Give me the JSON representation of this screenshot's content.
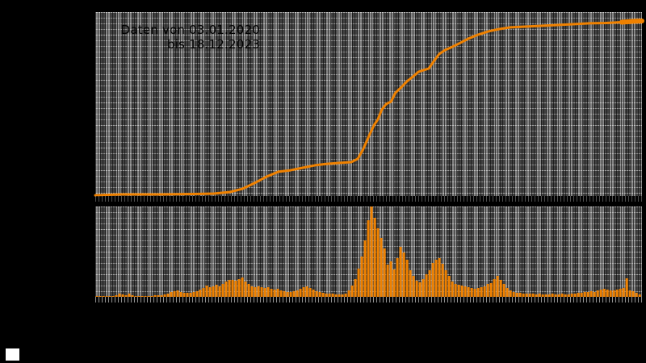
{
  "window": {
    "background": "#000000"
  },
  "annotation": {
    "line1": "Daten von 03.01.2020",
    "line2": "bis 18.12.2023"
  },
  "colors": {
    "accent_orange": "#ef8100",
    "panel_bg": "#636363",
    "grid_light": "#9a9a9a",
    "grid_dark": "#141414",
    "annotation_text": "#000000",
    "white_marker": "#ffffff",
    "frame_black": "#000000"
  },
  "chart_data": [
    {
      "id": "cumulative",
      "type": "line",
      "title": "",
      "description": "Top panel: cumulative total over time, orange line on dark gridded background",
      "x_range": {
        "start_label": "03.01.2020",
        "end_label": "18.12.2023"
      },
      "axis_tick_labels_visible": false,
      "grid": true,
      "legend_position": "none",
      "end_cap_thick": true,
      "points_pct": [
        [
          0,
          0.4
        ],
        [
          4.7,
          0.9
        ],
        [
          12.1,
          0.9
        ],
        [
          18.0,
          1.1
        ],
        [
          21.7,
          1.3
        ],
        [
          24.7,
          2.2
        ],
        [
          26.9,
          3.9
        ],
        [
          29.1,
          7.0
        ],
        [
          31.3,
          10.5
        ],
        [
          33.5,
          13.2
        ],
        [
          35.7,
          14.0
        ],
        [
          38.0,
          15.4
        ],
        [
          40.2,
          16.7
        ],
        [
          42.4,
          17.5
        ],
        [
          44.6,
          18.0
        ],
        [
          46.8,
          18.4
        ],
        [
          48.0,
          20.2
        ],
        [
          49.0,
          25.4
        ],
        [
          50.1,
          32.9
        ],
        [
          51.0,
          38.6
        ],
        [
          51.7,
          41.7
        ],
        [
          52.4,
          46.9
        ],
        [
          53.2,
          50.0
        ],
        [
          54.1,
          51.3
        ],
        [
          54.9,
          56.1
        ],
        [
          56.0,
          59.2
        ],
        [
          57.0,
          62.3
        ],
        [
          58.1,
          64.9
        ],
        [
          59.1,
          67.5
        ],
        [
          60.0,
          68.4
        ],
        [
          61.0,
          69.3
        ],
        [
          61.9,
          73.2
        ],
        [
          62.9,
          77.2
        ],
        [
          64.0,
          79.4
        ],
        [
          65.3,
          81.1
        ],
        [
          66.8,
          83.3
        ],
        [
          68.2,
          85.5
        ],
        [
          70.0,
          87.7
        ],
        [
          71.9,
          89.5
        ],
        [
          73.9,
          90.8
        ],
        [
          75.9,
          91.7
        ],
        [
          78.6,
          92.1
        ],
        [
          81.2,
          92.5
        ],
        [
          84.5,
          93.0
        ],
        [
          87.4,
          93.4
        ],
        [
          90.4,
          93.9
        ],
        [
          93.4,
          94.1
        ],
        [
          96.3,
          94.5
        ],
        [
          98.5,
          95.0
        ],
        [
          100,
          95.2
        ]
      ]
    },
    {
      "id": "daily",
      "type": "bar",
      "title": "",
      "description": "Bottom panel: daily values as dense orange spikes, tallest cluster at ~52% of time axis",
      "axis_tick_labels_visible": false,
      "grid": true,
      "legend_position": "none",
      "x_start_pct": 0.295,
      "x_step_pct": 0.591,
      "bar_width_pct": 0.45,
      "values_pct": [
        0.9,
        0.9,
        0.9,
        0.9,
        0.9,
        0.9,
        1.8,
        3.6,
        2.7,
        1.8,
        3.6,
        1.8,
        0.9,
        0.9,
        0.9,
        0.9,
        0.9,
        0.9,
        1.8,
        1.8,
        1.8,
        2.7,
        3.6,
        5.4,
        6.3,
        7.1,
        5.4,
        4.5,
        4.5,
        4.5,
        5.4,
        6.3,
        8.0,
        9.8,
        12.5,
        10.7,
        11.6,
        13.4,
        11.6,
        14.3,
        17.0,
        18.8,
        18.8,
        17.9,
        19.6,
        21.4,
        17.0,
        14.3,
        11.6,
        10.7,
        11.6,
        10.7,
        9.8,
        10.7,
        8.9,
        8.0,
        8.9,
        7.1,
        6.3,
        5.4,
        5.4,
        6.3,
        7.1,
        8.9,
        10.7,
        11.6,
        9.8,
        8.0,
        6.3,
        5.4,
        4.5,
        3.6,
        3.6,
        3.6,
        2.7,
        2.7,
        2.7,
        3.6,
        7.1,
        12.5,
        19.6,
        31.3,
        44.6,
        62.5,
        84.8,
        100,
        87.5,
        75.9,
        65.2,
        53.6,
        35.7,
        39.3,
        30.4,
        42.9,
        55.4,
        49.1,
        41.1,
        29.5,
        23.2,
        17.9,
        16.1,
        19.6,
        25.0,
        29.5,
        37.5,
        41.1,
        42.9,
        36.6,
        29.5,
        23.2,
        17.0,
        14.3,
        13.4,
        12.5,
        11.6,
        10.7,
        9.8,
        8.9,
        9.8,
        10.7,
        11.6,
        14.3,
        15.2,
        19.6,
        23.2,
        18.8,
        14.3,
        9.8,
        7.1,
        5.4,
        4.5,
        4.5,
        3.6,
        3.6,
        3.6,
        3.6,
        2.7,
        3.6,
        2.7,
        2.7,
        2.7,
        3.6,
        2.7,
        2.7,
        3.6,
        2.7,
        2.7,
        3.6,
        3.6,
        4.5,
        4.5,
        5.4,
        5.4,
        6.3,
        5.4,
        7.1,
        8.0,
        8.9,
        8.0,
        7.1,
        7.1,
        8.0,
        8.9,
        9.8,
        20.5,
        7.1,
        6.3,
        4.5,
        2.7
      ]
    }
  ]
}
